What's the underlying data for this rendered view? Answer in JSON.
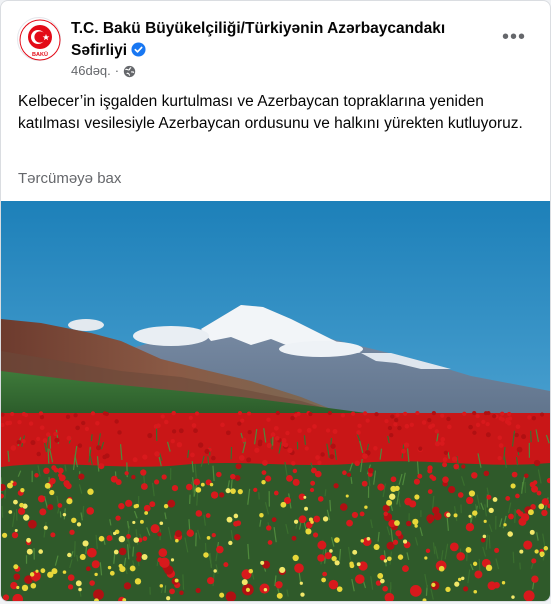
{
  "post": {
    "page_name": "T.C. Bakü Büyükelçiliği/Türkiyənin Azərbaycandakı Səfirliyi",
    "avatar_label": "BAKÜ",
    "timestamp": "46dəq.",
    "separator": "·",
    "audience_icon": "globe-icon",
    "verified_icon": "verified-badge-icon",
    "menu_icon": "more-options-icon",
    "menu_glyph": "•••",
    "text": "Kelbecer’in işgalden kurtulması ve Azerbaycan topraklarına yeniden katılması vesilesiyle Azerbaycan ordusunu ve halkını yürekten kutluyoruz.",
    "translate_label": "Tərcüməyə bax"
  },
  "colors": {
    "verified_blue": "#1877f2",
    "emblem_red": "#e30a17",
    "muted_text": "#65676b"
  }
}
